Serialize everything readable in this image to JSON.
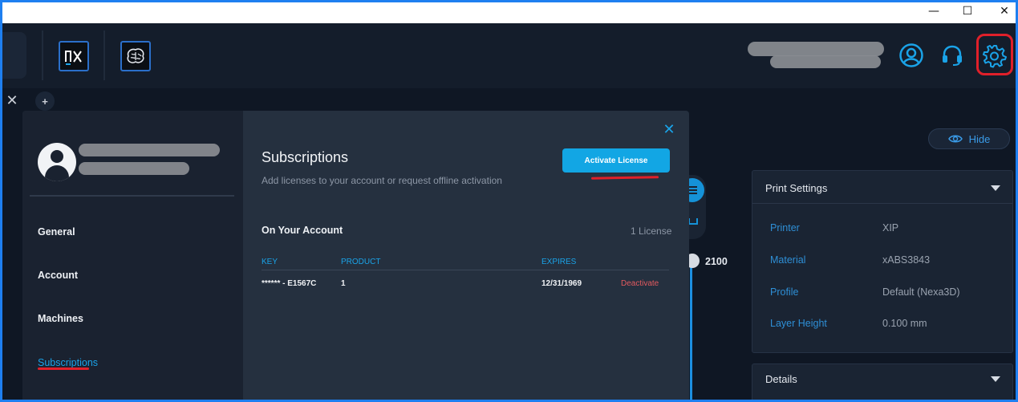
{
  "window": {
    "minimize_glyph": "—",
    "maximize_glyph": "☐",
    "close_glyph": "✕"
  },
  "header": {
    "apps": [
      {
        "name": "nx-app",
        "label": "nx"
      },
      {
        "name": "brain-app",
        "label": ""
      }
    ],
    "icons": [
      "account-icon",
      "support-headset-icon",
      "settings-gear-icon"
    ]
  },
  "tabs": {
    "close_glyph": "✕",
    "add_glyph": "+"
  },
  "workspace": {
    "hide_label": "Hide",
    "slider_value": "2100",
    "print_settings": {
      "title": "Print Settings",
      "rows": [
        {
          "label": "Printer",
          "value": "XIP"
        },
        {
          "label": "Material",
          "value": "xABS3843"
        },
        {
          "label": "Profile",
          "value": "Default (Nexa3D)"
        },
        {
          "label": "Layer Height",
          "value": "0.100 mm"
        }
      ]
    },
    "details_title": "Details"
  },
  "modal": {
    "close_glyph": "✕",
    "nav": [
      {
        "label": "General"
      },
      {
        "label": "Account"
      },
      {
        "label": "Machines"
      },
      {
        "label": "Subscriptions"
      }
    ],
    "title": "Subscriptions",
    "subtitle": "Add licenses to your account or request offline activation",
    "activate_label": "Activate License",
    "section_title": "On Your Account",
    "license_count": "1 License",
    "table": {
      "headers": [
        "KEY",
        "PRODUCT",
        "EXPIRES"
      ],
      "rows": [
        {
          "key": "****** - E1567C",
          "product": "1",
          "expires": "12/31/1969",
          "action": "Deactivate"
        }
      ]
    }
  },
  "colors": {
    "accent": "#12a6e4",
    "annotation_red": "#e0202a",
    "danger": "#e35a5f"
  }
}
